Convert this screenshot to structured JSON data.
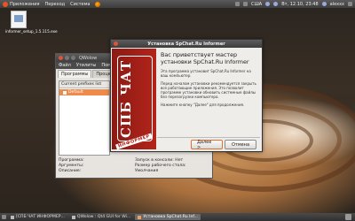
{
  "top_panel": {
    "menu": [
      {
        "label": "Приложения",
        "icon": "ubuntu-logo-icon"
      },
      {
        "label": "Переход"
      },
      {
        "label": "Система"
      }
    ],
    "lang": "СШA",
    "datetime": "Вт, 12.10, 23:48",
    "user": "alexxx"
  },
  "desktop": {
    "icon_label": "informer_setup_1.5.115.exe"
  },
  "bg_window": {
    "title": "QWolow",
    "menu": [
      "Файл",
      "Утилиты",
      "Помощь"
    ],
    "tabs": [
      "Программы",
      "Процесс",
      "Н"
    ],
    "list_header": "Current prefixes list",
    "list_items": [
      "Default"
    ],
    "info": {
      "program_label": "Программа:",
      "args_label": "Аргументы:",
      "desc_label": "Описание:",
      "console_label": "Запуск в консоли: Нет",
      "desktop_label": "Размер рабочего стола: Умолчания"
    }
  },
  "installer": {
    "title": "Установка SpChat.Ru Informer",
    "sidebar_logo": "СПБ ЧАТ",
    "sidebar_tag": "ИНФОРМЕР",
    "heading": "Вас приветствует мастер установки SpChat.Ru Informer",
    "para1": "Эта программа установит SpChat.Ru Informer на ваш компьютер.",
    "para2": "Перед началом установки рекомендуется закрыть все работающие приложения. Это позволит программе установки обновить системные файлы без перезагрузки компьютера.",
    "para3": "Нажмите кнопку \"Далее\" для продолжения.",
    "next_label": "Далее >",
    "cancel_label": "Отмена"
  },
  "taskbar": {
    "items": [
      {
        "label": "[СПБ ЧАТ ИНФОРМЕР..."
      },
      {
        "label": "QWolow : Qt4 GUI for Wi..."
      },
      {
        "label": "Установка SpChat.Ru Inf..."
      }
    ]
  },
  "colors": {
    "brand_red": "#b3241a",
    "ubuntu_orange": "#e95420",
    "selection": "#f08a4a"
  }
}
